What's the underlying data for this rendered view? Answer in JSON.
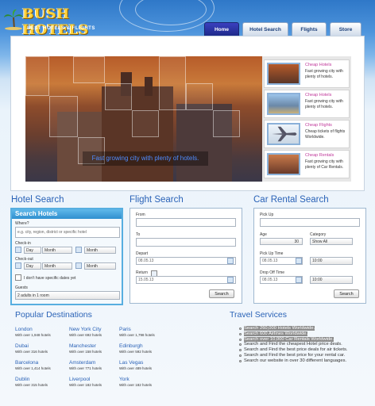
{
  "header": {
    "logo_title": "BUSH HOTELS",
    "logo_tagline": "BEST HOTELS & FLIGHTS",
    "tabs": [
      {
        "label": "Home",
        "active": true
      },
      {
        "label": "Hotel Search",
        "active": false
      },
      {
        "label": "Flights",
        "active": false
      },
      {
        "label": "Store",
        "active": false
      }
    ]
  },
  "hero": {
    "caption": "Fast growing city with plenty of hotels."
  },
  "offers": [
    {
      "title": "Cheap Hotels",
      "text": "Fast growing city with plenty of hotels."
    },
    {
      "title": "Cheap Hotels",
      "text": "Fast growing city with plenty of hotels."
    },
    {
      "title": "Cheap Flights",
      "text": "Cheap tickets of flights Worldwide."
    },
    {
      "title": "Cheap Rentals",
      "text": "Fast growing city with plenty of Car Rentals."
    }
  ],
  "hotel_search": {
    "section_title": "Hotel Search",
    "box_title": "Search Hotels",
    "where_label": "Where?",
    "where_placeholder": "e.g. city, region, district or specific hotel",
    "checkin_label": "Check-in",
    "checkout_label": "Check-out",
    "day_label": "Day",
    "month_label": "Month",
    "no_dates_label": "I don't have specific dates yet",
    "guests_label": "Guests",
    "guests_value": "2 adults in 1 room"
  },
  "flight_search": {
    "section_title": "Flight Search",
    "from_label": "From",
    "to_label": "To",
    "depart_label": "Depart",
    "depart_value": "08.05.13",
    "return_label": "Return",
    "return_value": "15.05.13",
    "search_button": "Search"
  },
  "car_rental": {
    "section_title": "Car Rental Search",
    "pickup_label": "Pick Up",
    "age_label": "Age",
    "age_value": "30",
    "category_label": "Category",
    "category_value": "Show All",
    "pickup_time_label": "Pick Up Time",
    "pickup_date": "08.05.13",
    "pickup_time": "10:00",
    "dropoff_time_label": "Drop Off Time",
    "dropoff_date": "08.05.13",
    "dropoff_time": "10:00",
    "search_button": "Search"
  },
  "destinations": {
    "title": "Popular Destinations",
    "items": [
      {
        "city": "London",
        "hotels": "With over 1,948 hotels"
      },
      {
        "city": "New York City",
        "hotels": "With over 692 hotels"
      },
      {
        "city": "Paris",
        "hotels": "With over 1,798 hotels"
      },
      {
        "city": "Dubai",
        "hotels": "With over 316 hotels"
      },
      {
        "city": "Manchester",
        "hotels": "With over 158 hotels"
      },
      {
        "city": "Edinburgh",
        "hotels": "With over 592 hotels"
      },
      {
        "city": "Barcelona",
        "hotels": "With over 1,414 hotels"
      },
      {
        "city": "Amsterdam",
        "hotels": "With over 771 hotels"
      },
      {
        "city": "Las Vegas",
        "hotels": "With over 489 hotels"
      },
      {
        "city": "Dublin",
        "hotels": "With over 315 hotels"
      },
      {
        "city": "Liverpool",
        "hotels": "With over 182 hotels"
      },
      {
        "city": "York",
        "hotels": "With over 182 hotels"
      }
    ]
  },
  "services": {
    "title": "Travel Services",
    "items": [
      {
        "text": "Search 260,000 Hotels Worldwide.",
        "highlight": true
      },
      {
        "text": "Search 600 Airlines Worldwide.",
        "highlight": true
      },
      {
        "text": "Search over 10,000 Car Rentals Worldwide.",
        "highlight": true
      },
      {
        "text": "Search and Find the cheapest Hotel price deals.",
        "highlight": false
      },
      {
        "text": "Search and Find the best price deals for air tickets.",
        "highlight": false
      },
      {
        "text": "Search and Find the best price for your rental car.",
        "highlight": false
      },
      {
        "text": "Search our website in over 30 different languages.",
        "highlight": false
      }
    ]
  },
  "colors": {
    "accent": "#2a62b7",
    "offer_title": "#c0399b",
    "tab_active": "#1d2a8a",
    "hotel_box_header": "#2f8fcf"
  }
}
